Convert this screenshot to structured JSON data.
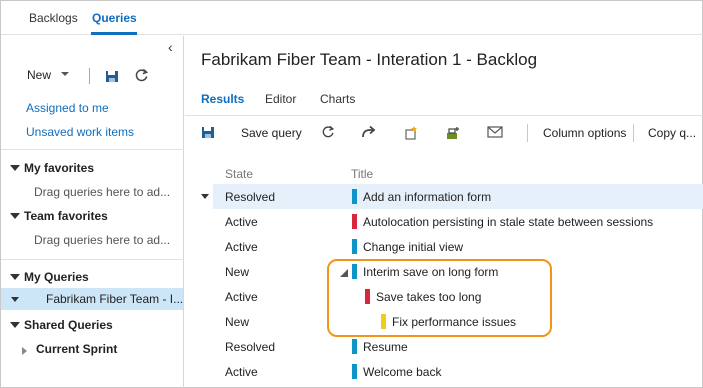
{
  "top_tabs": {
    "backlogs": "Backlogs",
    "queries": "Queries"
  },
  "left_panel": {
    "collapse_glyph": "‹",
    "new_label": "New",
    "links": {
      "assigned_to_me": "Assigned to me",
      "unsaved": "Unsaved work items"
    },
    "my_favorites": {
      "title": "My favorites",
      "hint": "Drag queries here to ad..."
    },
    "team_favorites": {
      "title": "Team favorites",
      "hint": "Drag queries here to ad..."
    },
    "my_queries": {
      "title": "My Queries",
      "selected": "Fabrikam Fiber Team - I..."
    },
    "shared_queries": {
      "title": "Shared Queries",
      "child": "Current Sprint"
    }
  },
  "main": {
    "title": "Fabrikam Fiber Team - Interation 1 - Backlog",
    "subtabs": {
      "results": "Results",
      "editor": "Editor",
      "charts": "Charts"
    },
    "toolbar": {
      "save_query": "Save query",
      "column_options": "Column options",
      "copy_query": "Copy q..."
    },
    "columns": {
      "state": "State",
      "title": "Title"
    },
    "rows": [
      {
        "state": "Resolved",
        "title": "Add an information form",
        "color": "#0e95c8"
      },
      {
        "state": "Active",
        "title": "Autolocation persisting in stale state between sessions",
        "color": "#d7263d"
      },
      {
        "state": "Active",
        "title": "Change initial view",
        "color": "#0e95c8"
      },
      {
        "state": "New",
        "title": "Interim save on long form",
        "color": "#0e95c8"
      },
      {
        "state": "Active",
        "title": "Save takes too long",
        "color": "#d7263d"
      },
      {
        "state": "New",
        "title": "Fix performance issues",
        "color": "#f2cb1d"
      },
      {
        "state": "Resolved",
        "title": "Resume",
        "color": "#0e95c8"
      },
      {
        "state": "Active",
        "title": "Welcome back",
        "color": "#0e95c8"
      }
    ]
  },
  "colors": {
    "accent": "#106ebe",
    "highlight": "#f0951c",
    "selection": "#cde6f7"
  }
}
